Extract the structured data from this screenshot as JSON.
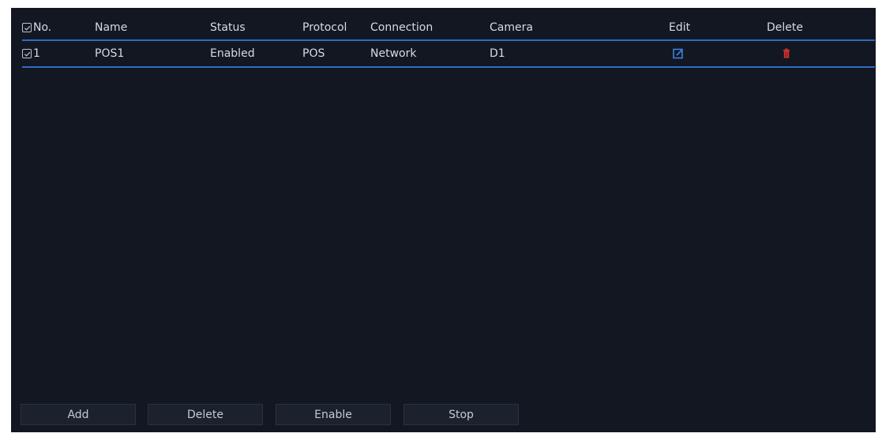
{
  "header": {
    "no": "No.",
    "name": "Name",
    "status": "Status",
    "protocol": "Protocol",
    "connection": "Connection",
    "camera": "Camera",
    "edit": "Edit",
    "delete": "Delete"
  },
  "rows": [
    {
      "no": "1",
      "name": "POS1",
      "status": "Enabled",
      "protocol": "POS",
      "connection": "Network",
      "camera": "D1",
      "checked": true
    }
  ],
  "buttons": {
    "add": "Add",
    "delete": "Delete",
    "enable": "Enable",
    "stop": "Stop"
  },
  "colors": {
    "background": "#121722",
    "accent": "#2f6cc4",
    "delete_icon": "#d5332f"
  },
  "icons": {
    "checkbox": "checkbox-checked-icon",
    "edit": "edit-icon",
    "delete": "trash-icon"
  }
}
